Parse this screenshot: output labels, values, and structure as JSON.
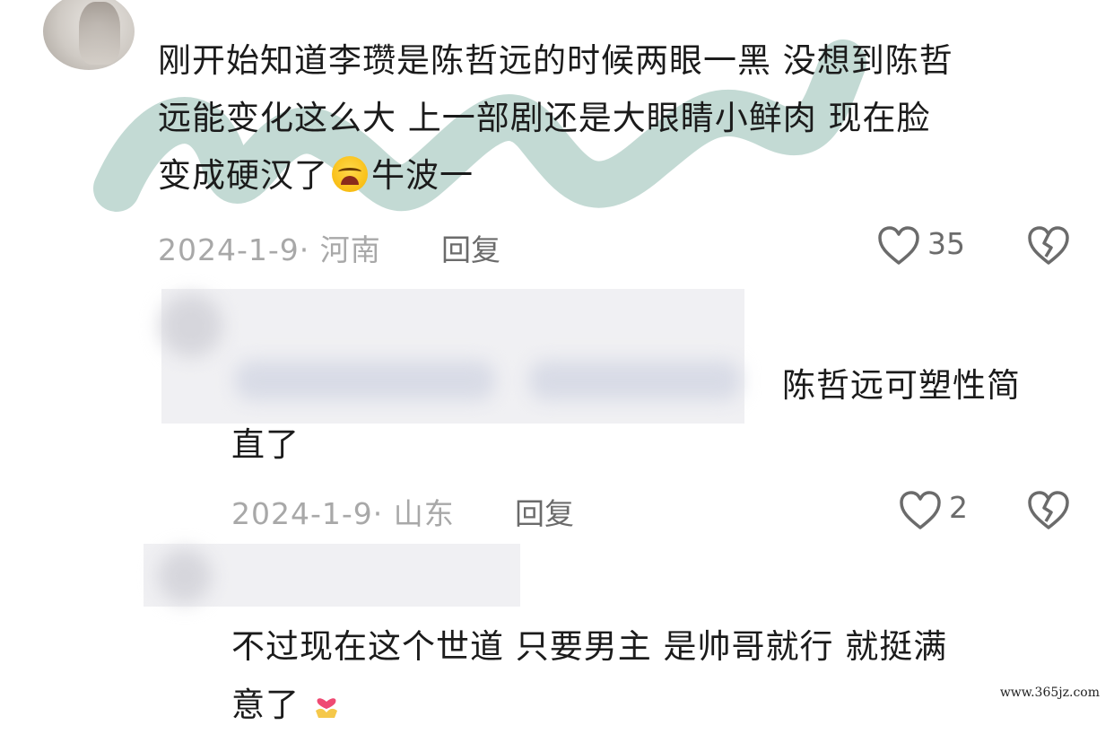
{
  "comments": [
    {
      "text": "刚开始知道李瓒是陈哲远的时候两眼一黑 没想到陈哲远能变化这么大 上一部剧还是大眼睛小鲜肉 现在脸变成硬汉了",
      "line1": "刚开始知道李瓒是陈哲远的时候两眼一黑 没想到陈哲",
      "line2": "远能变化这么大 上一部剧还是大眼睛小鲜肉 现在脸",
      "line3_a": "变成硬汉了",
      "line3_b": "牛波一",
      "emoji": "loudly-crying-face",
      "date_location": "2024-1-9· 河南",
      "reply_label": "回复",
      "like_count": "35"
    },
    {
      "line1": "陈哲远可塑性简",
      "line2": "直了",
      "date_location": "2024-1-9· 山东",
      "reply_label": "回复",
      "like_count": "2"
    },
    {
      "line1": "不过现在这个世道 只要男主 是帅哥就行 就挺满",
      "line2": "意了",
      "emoji": "heart-hands"
    }
  ],
  "site_watermark": "www.365jz.com",
  "colors": {
    "watermark_stroke": "#b9d3cd",
    "icon_gray": "#6b6b6b",
    "meta_gray": "#a8a8a8"
  }
}
